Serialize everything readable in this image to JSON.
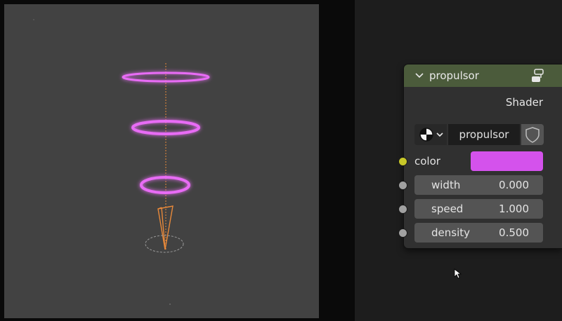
{
  "node": {
    "title": "propulsor",
    "header_color": "#4b5b3b",
    "output_label": "Shader",
    "material_name": "propulsor",
    "color_label": "color",
    "color_value": "#d452ec",
    "inputs": [
      {
        "label": "width",
        "value": "0.000"
      },
      {
        "label": "speed",
        "value": "1.000"
      },
      {
        "label": "density",
        "value": "0.500"
      }
    ]
  },
  "icons": {
    "collapse": "chevron-down-icon",
    "group": "node-group-icon",
    "material": "material-sphere-icon",
    "fake_user": "shield-icon",
    "cursor": "mouse-cursor-icon"
  },
  "colors": {
    "ring": "#e86cf5",
    "emitter": "#e8893a",
    "shader_socket": "#63c763",
    "color_socket": "#c7c729",
    "value_socket": "#a1a1a1"
  }
}
